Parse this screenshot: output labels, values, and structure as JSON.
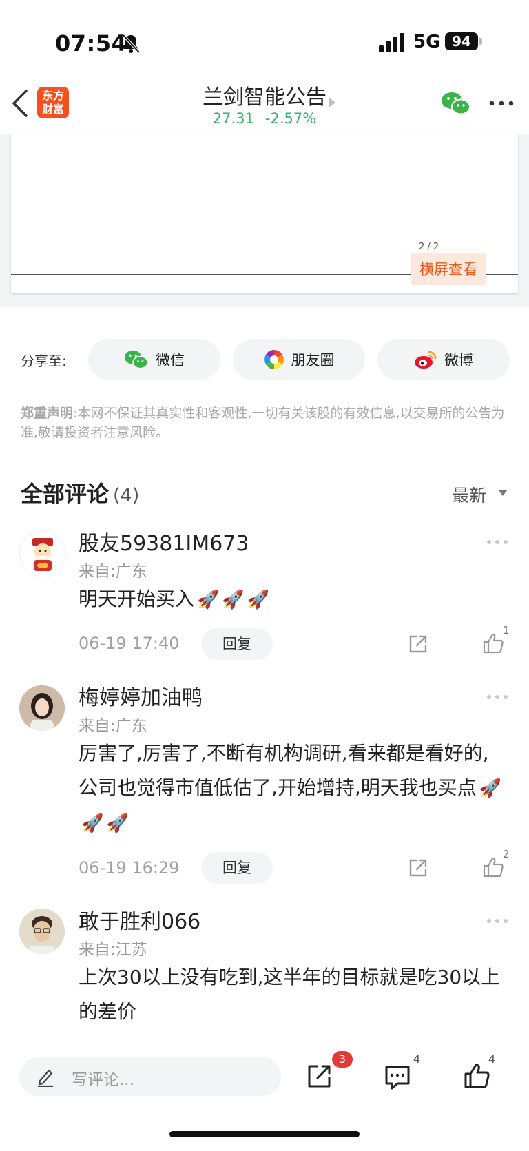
{
  "status_bar": {
    "time": "07:54",
    "network": "5G",
    "battery": "94"
  },
  "nav": {
    "logo_line1": "东方",
    "logo_line2": "财富",
    "title": "兰剑智能公告",
    "price": "27.31",
    "change": "-2.57%"
  },
  "doc": {
    "page_indicator": "2 / 2",
    "landscape_label": "横屏查看"
  },
  "share": {
    "label": "分享至:",
    "wechat": "微信",
    "moments": "朋友圈",
    "weibo": "微博"
  },
  "disclaimer": {
    "head": "郑重声明",
    "body": ":本网不保证其真实性和客观性,一切有关该股的有效信息,以交易所的公告为准,敬请投资者注意风险。"
  },
  "comments_header": {
    "title": "全部评论",
    "count": "(4)",
    "sort": "最新"
  },
  "comments": [
    {
      "name": "股友59381IM673",
      "region": "来自:广东",
      "text": "明天开始买入",
      "time": "06-19 17:40",
      "reply_label": "回复",
      "likes": "1"
    },
    {
      "name": "梅婷婷加油鸭",
      "region": "来自:广东",
      "text": "厉害了,厉害了,不断有机构调研,看来都是看好的,公司也觉得市值低估了,开始增持,明天我也买点",
      "time": "06-19 16:29",
      "reply_label": "回复",
      "likes": "2"
    },
    {
      "name": "敢于胜利066",
      "region": "来自:江苏",
      "text": "上次30以上没有吃到,这半年的目标就是吃30以上的差价"
    }
  ],
  "bottom_bar": {
    "write_placeholder": "写评论...",
    "share_badge": "3",
    "comment_count": "4",
    "like_count": "4"
  }
}
